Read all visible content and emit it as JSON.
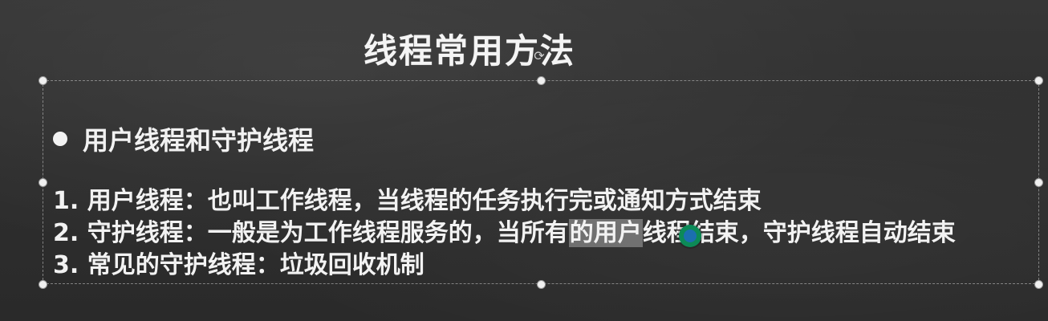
{
  "slide": {
    "title": "线程常用方法",
    "bullet": "用户线程和守护线程",
    "items": [
      "1. 用户线程：也叫工作线程，当线程的任务执行完或通知方式结束",
      {
        "before": "2. 守护线程：一般是为工作线程服务的，当所有",
        "highlight": "的用户",
        "after": "线程结束，守护线程自动结束"
      },
      "3. 常见的守护线程：垃圾回收机制"
    ]
  },
  "icons": {
    "rotate_handle": "rotate-icon",
    "selection_handle": "resize-handle-icon",
    "bullet": "bullet-dot-icon",
    "cursor_badge": "app-cursor-badge-icon"
  },
  "colors": {
    "background": "#2e2e2e",
    "text": "#f2f2f2",
    "selection_highlight": "#9e9e9e",
    "badge_outer": "#0c8a57",
    "badge_inner": "#1b6fb0"
  }
}
